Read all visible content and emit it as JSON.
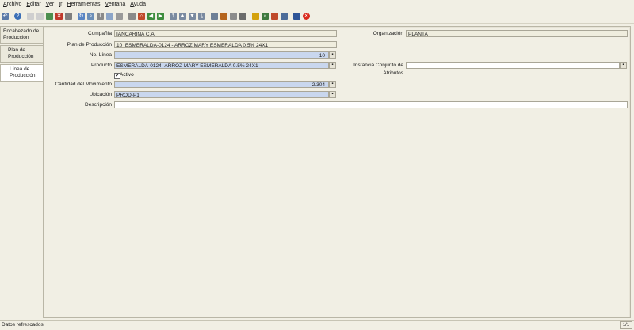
{
  "menu": [
    "Archivo",
    "Editar",
    "Ver",
    "Ir",
    "Herramientas",
    "Ventana",
    "Ayuda"
  ],
  "toolbar_icons": [
    {
      "name": "undo-icon",
      "color": "#5a79a8",
      "glyph": "↶"
    },
    {
      "name": "help-icon",
      "color": "#3b6fb6",
      "glyph": "?"
    },
    {
      "name": "new-record-icon",
      "color": "#cfcfcf",
      "glyph": ""
    },
    {
      "name": "copy-record-icon",
      "color": "#cfcfcf",
      "glyph": ""
    },
    {
      "name": "save-icon",
      "color": "#4c8f4f",
      "glyph": ""
    },
    {
      "name": "delete-icon",
      "color": "#c0392b",
      "glyph": "✕"
    },
    {
      "name": "grid-toggle-icon",
      "color": "#7f7f7f",
      "glyph": ""
    },
    {
      "name": "refresh-icon",
      "color": "#5a86c4",
      "glyph": "↻"
    },
    {
      "name": "find-icon",
      "color": "#6c8fb8",
      "glyph": "⌕"
    },
    {
      "name": "attachment-icon",
      "color": "#8a8a8a",
      "glyph": "⌇"
    },
    {
      "name": "chat-icon",
      "color": "#8ca5c8",
      "glyph": ""
    },
    {
      "name": "history-icon",
      "color": "#9a9a9a",
      "glyph": ""
    },
    {
      "name": "home-icon",
      "color": "#8a8a8a",
      "glyph": ""
    },
    {
      "name": "menu-icon",
      "color": "#c04a2b",
      "glyph": "⌂"
    },
    {
      "name": "parent-icon",
      "color": "#3e8d3e",
      "glyph": "◀"
    },
    {
      "name": "detail-icon",
      "color": "#3e8d3e",
      "glyph": "▶"
    },
    {
      "name": "first-record-icon",
      "color": "#7a8aa0",
      "glyph": "⤒"
    },
    {
      "name": "previous-record-icon",
      "color": "#7a8aa0",
      "glyph": "▲"
    },
    {
      "name": "next-record-icon",
      "color": "#7a8aa0",
      "glyph": "▼"
    },
    {
      "name": "last-record-icon",
      "color": "#7a8aa0",
      "glyph": "⤓"
    },
    {
      "name": "report-icon",
      "color": "#6d7f96",
      "glyph": ""
    },
    {
      "name": "archived-docs-icon",
      "color": "#b5651d",
      "glyph": ""
    },
    {
      "name": "print-preview-icon",
      "color": "#8c8c8c",
      "glyph": ""
    },
    {
      "name": "print-icon",
      "color": "#6c6c6c",
      "glyph": ""
    },
    {
      "name": "lock-icon",
      "color": "#d4a20e",
      "glyph": ""
    },
    {
      "name": "zoom-across-icon",
      "color": "#3f7a3f",
      "glyph": "⌕"
    },
    {
      "name": "request-icon",
      "color": "#c04a2b",
      "glyph": ""
    },
    {
      "name": "product-info-icon",
      "color": "#4d6d9a",
      "glyph": ""
    },
    {
      "name": "workflow-icon",
      "color": "#2f5597",
      "glyph": ""
    },
    {
      "name": "close-window-icon",
      "color": "#d9291c",
      "glyph": "✕"
    }
  ],
  "tabs": [
    "Encabezado de Producción",
    "Plan de Producción",
    "Línea de Producción"
  ],
  "form": {
    "company_label": "Compañía",
    "company_value": "IANCARINA C.A",
    "org_label": "Organización",
    "org_value": "PLANTA",
    "plan_label": "Plan de Producción",
    "plan_value": "10_ESMERALDA-0124 - ARROZ MARY ESMERALDA 0.5% 24X1",
    "line_label": "No. Línea",
    "line_value": "10",
    "product_label": "Producto",
    "product_value": "ESMERALDA-0124_ARROZ MARY ESMERALDA 0.5% 24X1",
    "attr_label": "Instancia Conjunto de Atributos",
    "attr_value": "",
    "active_label": "Activo",
    "active_checked": true,
    "qty_label": "Cantidad del Movimiento",
    "qty_value": "2.304",
    "locator_label": "Ubicación",
    "locator_value": "PROD-P1",
    "desc_label": "Descripción",
    "desc_value": ""
  },
  "status": {
    "message": "Datos refrescados",
    "page": "1/1"
  },
  "colors": {
    "background": "#f1efe4",
    "mandatory_field": "#c9d7ee",
    "readonly_field": "#efedde"
  }
}
